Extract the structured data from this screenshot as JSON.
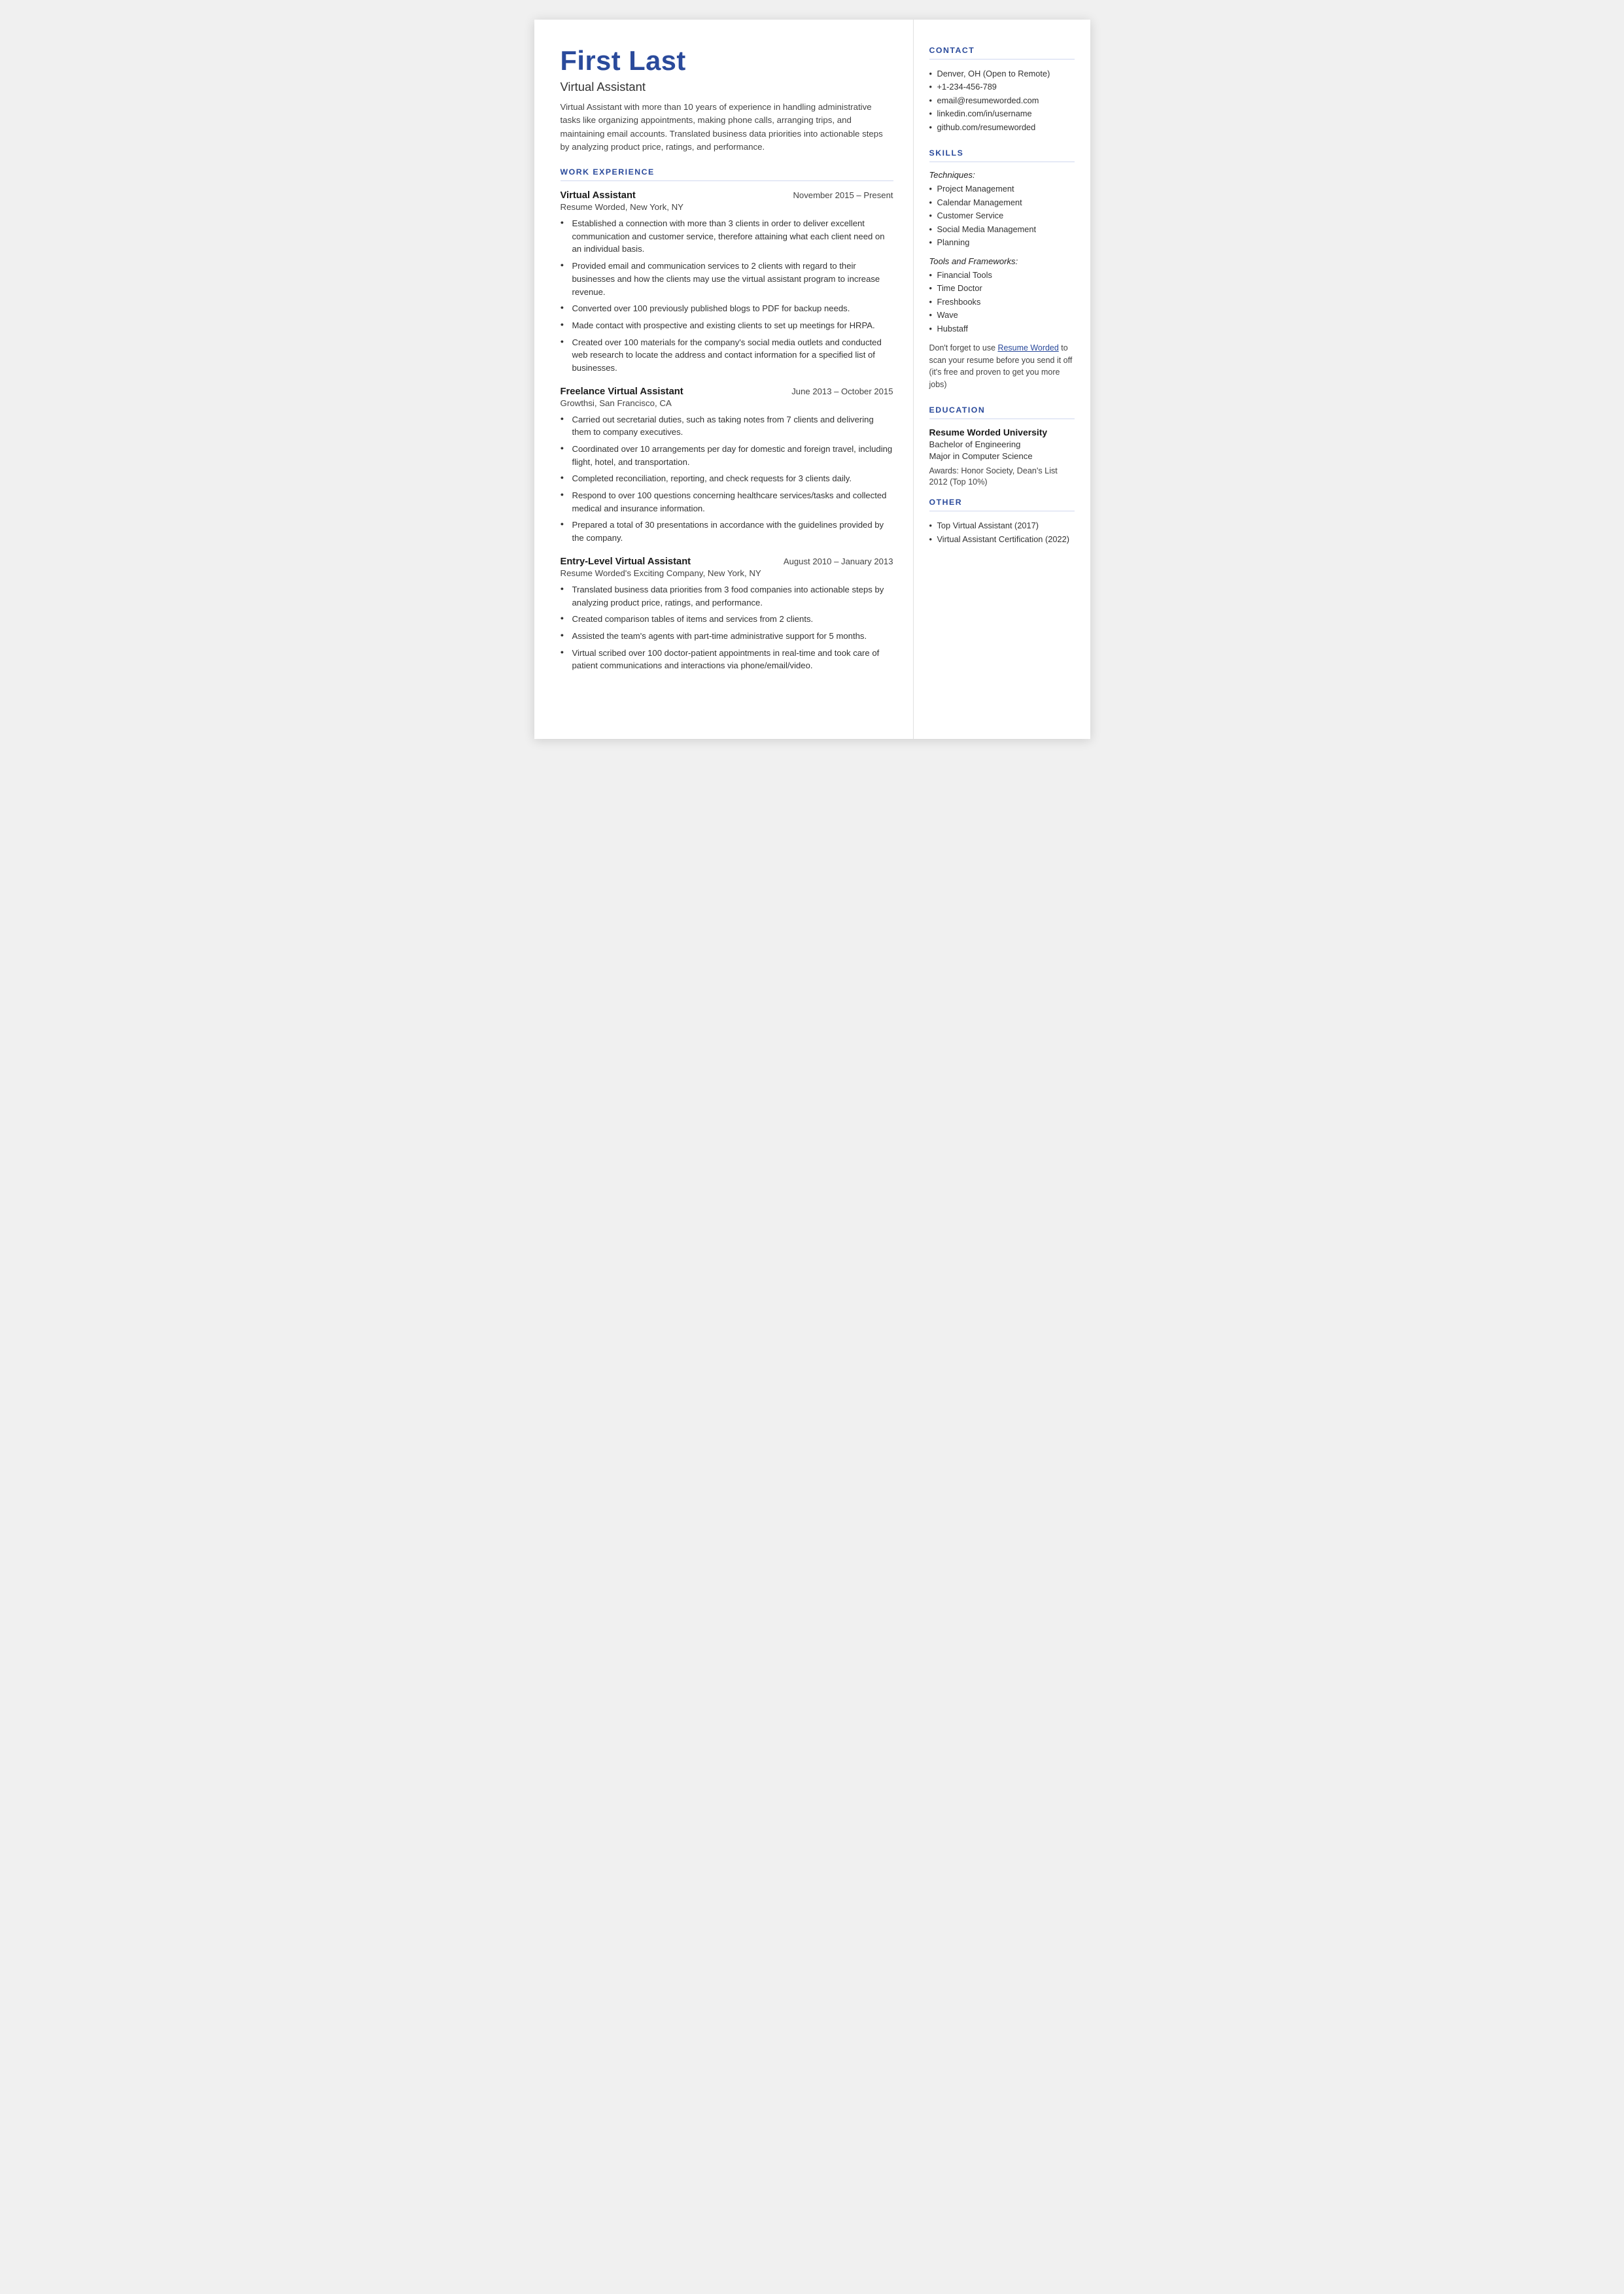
{
  "header": {
    "name": "First Last",
    "job_title": "Virtual Assistant",
    "summary": "Virtual Assistant with more than 10 years of experience in handling administrative tasks like organizing appointments, making phone calls, arranging trips, and maintaining email accounts. Translated business data priorities into actionable steps by analyzing product price, ratings, and performance."
  },
  "sections": {
    "work_experience_label": "WORK EXPERIENCE",
    "jobs": [
      {
        "title": "Virtual Assistant",
        "dates": "November 2015 – Present",
        "company": "Resume Worded, New York, NY",
        "bullets": [
          "Established a connection with more than 3 clients in order to deliver excellent communication and customer service, therefore attaining what each client need on an individual basis.",
          "Provided email and communication services to 2 clients with regard to their businesses and how the clients may use the virtual assistant program to increase revenue.",
          "Converted over 100 previously published blogs to PDF for backup needs.",
          "Made contact with prospective and existing clients to set up meetings for HRPA.",
          "Created over 100 materials for the company's social media outlets and conducted web research to locate the address and contact information for a specified list of businesses."
        ]
      },
      {
        "title": "Freelance Virtual Assistant",
        "dates": "June 2013 – October 2015",
        "company": "Growthsi, San Francisco, CA",
        "bullets": [
          "Carried out secretarial duties, such as taking notes from 7 clients and delivering them to company executives.",
          "Coordinated over 10 arrangements per day for domestic and foreign travel, including flight, hotel, and transportation.",
          "Completed reconciliation, reporting, and check requests for 3 clients daily.",
          "Respond to over 100 questions concerning healthcare services/tasks and collected medical and insurance information.",
          "Prepared a total of 30 presentations in accordance with the guidelines provided by the company."
        ]
      },
      {
        "title": "Entry-Level Virtual Assistant",
        "dates": "August 2010 – January 2013",
        "company": "Resume Worded's Exciting Company, New York, NY",
        "bullets": [
          "Translated business data priorities from 3 food companies into actionable steps by analyzing product price, ratings, and performance.",
          "Created comparison tables of items and services from 2 clients.",
          "Assisted the team's agents with part-time administrative support for 5 months.",
          "Virtual scribed over 100 doctor-patient appointments in real-time and took care of patient communications and interactions via phone/email/video."
        ]
      }
    ]
  },
  "contact": {
    "label": "CONTACT",
    "items": [
      "Denver, OH (Open to Remote)",
      "+1-234-456-789",
      "email@resumeworded.com",
      "linkedin.com/in/username",
      "github.com/resumeworded"
    ]
  },
  "skills": {
    "label": "SKILLS",
    "techniques_label": "Techniques:",
    "techniques": [
      "Project Management",
      "Calendar Management",
      "Customer Service",
      "Social Media Management",
      "Planning"
    ],
    "tools_label": "Tools and Frameworks:",
    "tools": [
      "Financial Tools",
      "Time Doctor",
      "Freshbooks",
      "Wave",
      "Hubstaff"
    ],
    "note_pre": "Don't forget to use ",
    "note_link": "Resume Worded",
    "note_post": " to scan your resume before you send it off (it's free and proven to get you more jobs)"
  },
  "education": {
    "label": "EDUCATION",
    "school": "Resume Worded University",
    "degree": "Bachelor of Engineering",
    "major": "Major in Computer Science",
    "awards": "Awards: Honor Society, Dean's List 2012 (Top 10%)"
  },
  "other": {
    "label": "OTHER",
    "items": [
      "Top Virtual Assistant (2017)",
      "Virtual Assistant Certification (2022)"
    ]
  }
}
